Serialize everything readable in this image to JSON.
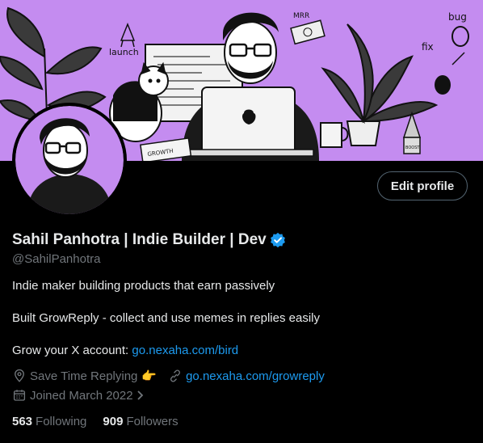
{
  "banner": {
    "doodle_texts": [
      "launch",
      "MRR",
      "bug",
      "fix",
      "BOOST",
      "GROWTH"
    ]
  },
  "profile": {
    "name": "Sahil Panhotra | Indie Builder | Dev",
    "handle": "@SahilPanhotra",
    "edit_profile_label": "Edit profile",
    "verified_icon": "verified-badge-icon"
  },
  "bio": {
    "line1": "Indie maker building products that earn passively",
    "line2": "Built GrowReply - collect and use memes in replies easily",
    "line3_text": "Grow your X account: ",
    "line3_link": "go.nexaha.com/bird"
  },
  "meta": {
    "location": "Save Time Replying",
    "location_emoji": "👉",
    "website": "go.nexaha.com/growreply",
    "joined": "Joined March 2022"
  },
  "stats": {
    "following_count": "563",
    "following_label": "Following",
    "followers_count": "909",
    "followers_label": "Followers"
  },
  "colors": {
    "accent": "#1d9bf0",
    "banner_bg": "#c48cf0",
    "muted": "#71767b"
  }
}
